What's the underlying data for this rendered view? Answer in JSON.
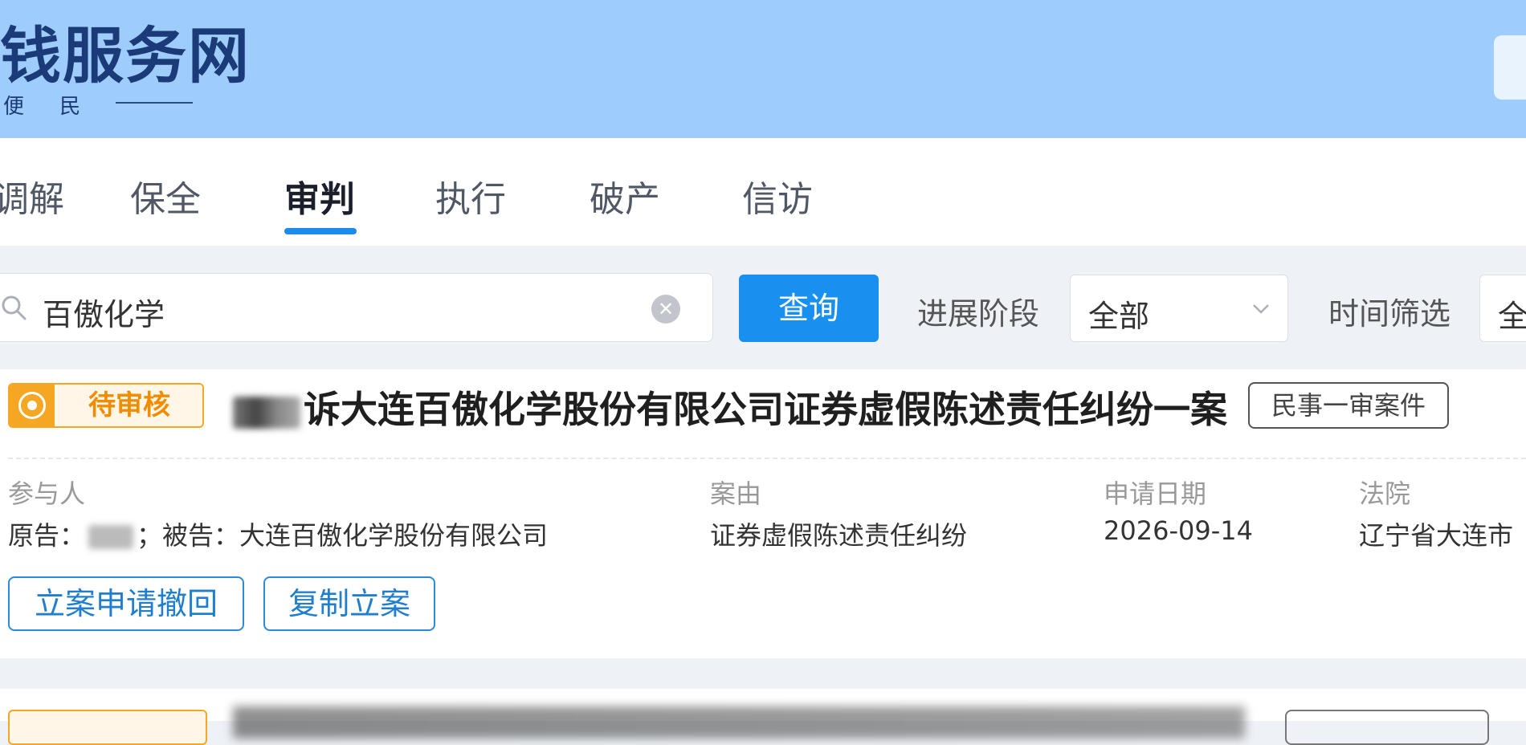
{
  "header": {
    "site_title": "钱服务网",
    "slogan": "便 民"
  },
  "tabs": [
    {
      "label": "调解",
      "active": false
    },
    {
      "label": "保全",
      "active": false
    },
    {
      "label": "审判",
      "active": true
    },
    {
      "label": "执行",
      "active": false
    },
    {
      "label": "破产",
      "active": false
    },
    {
      "label": "信访",
      "active": false
    }
  ],
  "filters": {
    "search_value": "百傲化学",
    "query_button": "查询",
    "stage_label": "进展阶段",
    "stage_value": "全部",
    "time_label": "时间筛选",
    "time_value": "全"
  },
  "case": {
    "status": "待审核",
    "title": "诉大连百傲化学股份有限公司证券虚假陈述责任纠纷一案",
    "case_type": "民事一审案件",
    "participants_label": "参与人",
    "plaintiff_prefix": "原告：",
    "defendant_text": "；被告：大连百傲化学股份有限公司",
    "cause_label": "案由",
    "cause_value": "证券虚假陈述责任纠纷",
    "date_label": "申请日期",
    "date_value": "2026-09-14",
    "court_label": "法院",
    "court_value": "辽宁省大连市",
    "withdraw_button": "立案申请撤回",
    "copy_button": "复制立案"
  },
  "colors": {
    "header_bg": "#9fcdfb",
    "accent_blue": "#1890f0",
    "status_orange": "#f5a623"
  }
}
